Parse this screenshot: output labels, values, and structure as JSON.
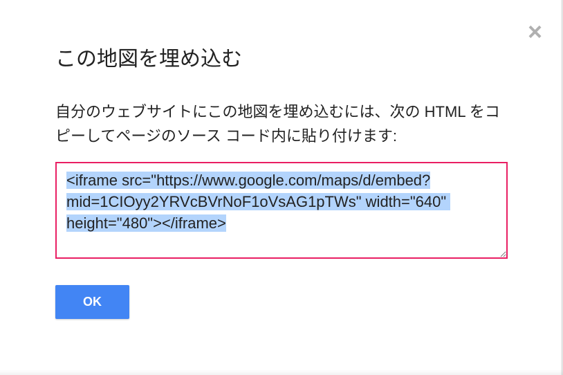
{
  "dialog": {
    "title": "この地図を埋め込む",
    "description": "自分のウェブサイトにこの地図を埋め込むには、次の HTML をコピーしてページのソース コード内に貼り付けます:",
    "embed_code": "<iframe src=\"https://www.google.com/maps/d/embed?mid=1CIOyy2YRVcBVrNoF1oVsAG1pTWs\" width=\"640\" height=\"480\"></iframe>",
    "ok_label": "OK",
    "close_label": "×"
  }
}
